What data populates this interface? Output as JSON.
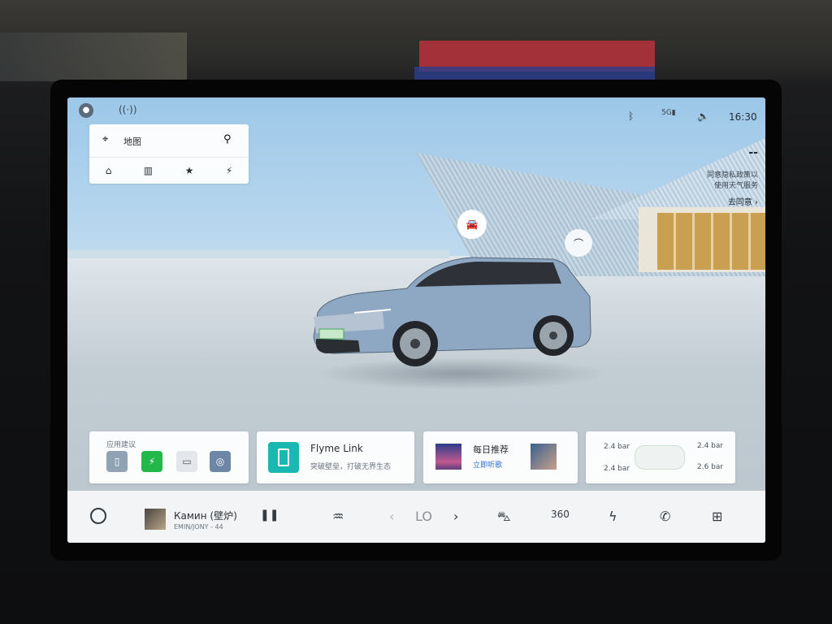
{
  "status_bar": {
    "time": "16:30",
    "signal_label": "5G",
    "icons": [
      "user-icon",
      "hotspot-icon",
      "bluetooth-icon",
      "signal-icon",
      "volume-icon"
    ]
  },
  "map_widget": {
    "title": "地图",
    "shortcuts": [
      "home-icon",
      "office-icon",
      "favorite-icon",
      "charging-icon"
    ]
  },
  "weather_widget": {
    "temp": "--",
    "notice_line1": "同意隐私政策以",
    "notice_line2": "使用天气服务",
    "link": "去同意 ›"
  },
  "cards": {
    "app_suggest": {
      "title": "应用建议"
    },
    "flyme": {
      "title": "Flyme Link",
      "subtitle": "突破壁垒，打破无界生态"
    },
    "daily": {
      "title": "每日推荐",
      "link": "立即听歌"
    },
    "tires": {
      "fl": "2.4 bar",
      "fr": "2.4 bar",
      "rl": "2.4 bar",
      "rr": "2.6 bar"
    }
  },
  "dock": {
    "song_title": "Камин (壁炉)",
    "song_artist": "EMIN/JONY - 44",
    "temp_value": "LO"
  },
  "colors": {
    "accent_teal": "#1ab8b0",
    "link_blue": "#2b6fd6",
    "charge_green": "#22b84a",
    "sign_red": "#b7333d"
  }
}
